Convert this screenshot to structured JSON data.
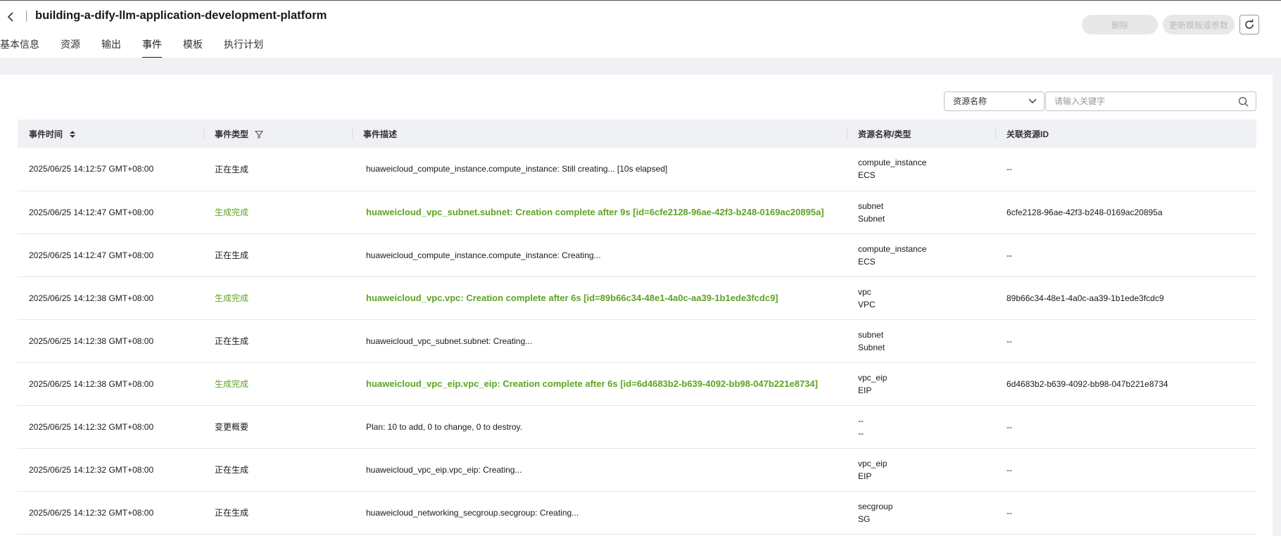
{
  "header": {
    "title": "building-a-dify-llm-application-development-platform",
    "delete_label": "删除",
    "update_label": "更新模板或参数"
  },
  "tabs": [
    {
      "label": "基本信息"
    },
    {
      "label": "资源"
    },
    {
      "label": "输出"
    },
    {
      "label": "事件",
      "active": true
    },
    {
      "label": "模板"
    },
    {
      "label": "执行计划"
    }
  ],
  "filter": {
    "select_value": "资源名称",
    "search_placeholder": "请输入关键字"
  },
  "table": {
    "columns": [
      "事件时间",
      "事件类型",
      "事件描述",
      "资源名称/类型",
      "关联资源ID"
    ],
    "rows": [
      {
        "time": "2025/06/25 14:12:57 GMT+08:00",
        "type": "正在生成",
        "status": "normal",
        "desc": "huaweicloud_compute_instance.compute_instance: Still creating... [10s elapsed]",
        "res_name": "compute_instance",
        "res_type": "ECS",
        "res_id": "--"
      },
      {
        "time": "2025/06/25 14:12:47 GMT+08:00",
        "type": "生成完成",
        "status": "complete",
        "desc": "huaweicloud_vpc_subnet.subnet: Creation complete after 9s [id=6cfe2128-96ae-42f3-b248-0169ac20895a]",
        "res_name": "subnet",
        "res_type": "Subnet",
        "res_id": "6cfe2128-96ae-42f3-b248-0169ac20895a"
      },
      {
        "time": "2025/06/25 14:12:47 GMT+08:00",
        "type": "正在生成",
        "status": "normal",
        "desc": "huaweicloud_compute_instance.compute_instance: Creating...",
        "res_name": "compute_instance",
        "res_type": "ECS",
        "res_id": "--"
      },
      {
        "time": "2025/06/25 14:12:38 GMT+08:00",
        "type": "生成完成",
        "status": "complete",
        "desc": "huaweicloud_vpc.vpc: Creation complete after 6s [id=89b66c34-48e1-4a0c-aa39-1b1ede3fcdc9]",
        "res_name": "vpc",
        "res_type": "VPC",
        "res_id": "89b66c34-48e1-4a0c-aa39-1b1ede3fcdc9"
      },
      {
        "time": "2025/06/25 14:12:38 GMT+08:00",
        "type": "正在生成",
        "status": "normal",
        "desc": "huaweicloud_vpc_subnet.subnet: Creating...",
        "res_name": "subnet",
        "res_type": "Subnet",
        "res_id": "--"
      },
      {
        "time": "2025/06/25 14:12:38 GMT+08:00",
        "type": "生成完成",
        "status": "complete",
        "desc": "huaweicloud_vpc_eip.vpc_eip: Creation complete after 6s [id=6d4683b2-b639-4092-bb98-047b221e8734]",
        "res_name": "vpc_eip",
        "res_type": "EIP",
        "res_id": "6d4683b2-b639-4092-bb98-047b221e8734"
      },
      {
        "time": "2025/06/25 14:12:32 GMT+08:00",
        "type": "变更概要",
        "status": "normal",
        "desc": "Plan: 10 to add, 0 to change, 0 to destroy.",
        "res_name": "--",
        "res_type": "--",
        "res_id": "--"
      },
      {
        "time": "2025/06/25 14:12:32 GMT+08:00",
        "type": "正在生成",
        "status": "normal",
        "desc": "huaweicloud_vpc_eip.vpc_eip: Creating...",
        "res_name": "vpc_eip",
        "res_type": "EIP",
        "res_id": "--"
      },
      {
        "time": "2025/06/25 14:12:32 GMT+08:00",
        "type": "正在生成",
        "status": "normal",
        "desc": "huaweicloud_networking_secgroup.secgroup: Creating...",
        "res_name": "secgroup",
        "res_type": "SG",
        "res_id": "--"
      }
    ]
  },
  "colors": {
    "complete_green": "#5fa323",
    "header_bg": "#f0f1f5"
  }
}
